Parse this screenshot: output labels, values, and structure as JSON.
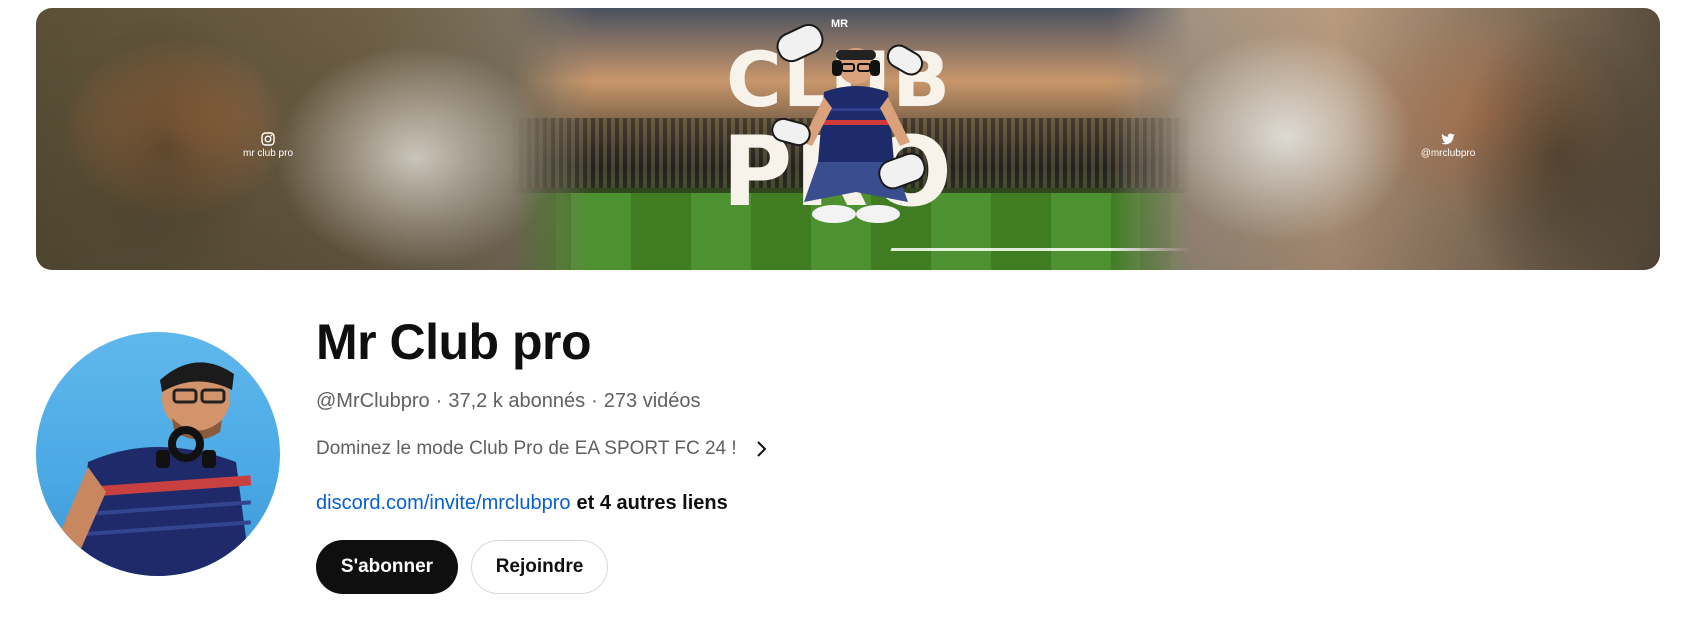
{
  "banner": {
    "logo_top": "MR",
    "logo_line1": "CLUB",
    "logo_line2": "PRO",
    "instagram_handle": "mr club pro",
    "twitter_handle": "@mrclubpro",
    "left_icon": "instagram-icon",
    "right_icon": "twitter-icon"
  },
  "channel": {
    "name": "Mr Club pro",
    "handle": "@MrClubpro",
    "separator": "·",
    "subscribers": "37,2 k abonnés",
    "videos": "273 vidéos",
    "description": "Dominez le mode Club Pro de EA SPORT FC 24 !",
    "description_icon": "chevron-right-icon",
    "primary_link": "discord.com/invite/mrclubpro",
    "more_links": "et 4 autres liens"
  },
  "actions": {
    "subscribe_label": "S'abonner",
    "join_label": "Rejoindre"
  },
  "colors": {
    "link": "#065fd4",
    "subscribe_bg": "#0f0f0f",
    "subscribe_text": "#ffffff",
    "secondary_text": "#606060",
    "title_text": "#0f0f0f"
  }
}
